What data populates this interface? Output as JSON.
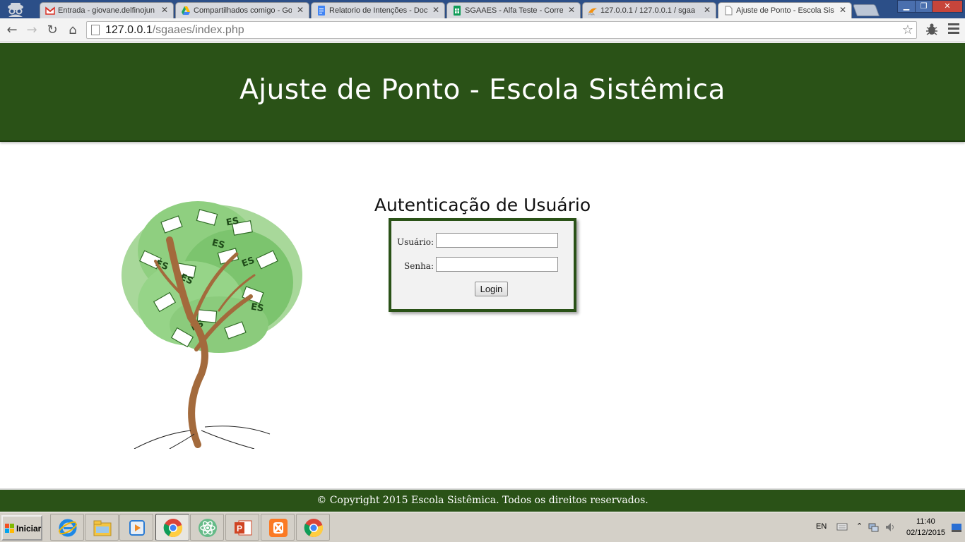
{
  "browser": {
    "tabs": [
      {
        "title": "Entrada - giovane.delfinojun",
        "icon": "gmail-icon",
        "color": "#d93025",
        "active": false
      },
      {
        "title": "Compartilhados comigo - Go",
        "icon": "drive-icon",
        "color": "#1fa463",
        "active": false
      },
      {
        "title": "Relatorio de Intenções - Doc",
        "icon": "docs-icon",
        "color": "#4285f4",
        "active": false
      },
      {
        "title": "SGAAES - Alfa Teste - Corre",
        "icon": "sheets-icon",
        "color": "#0f9d58",
        "active": false
      },
      {
        "title": "127.0.0.1 / 127.0.0.1 / sgaa",
        "icon": "phpmyadmin-icon",
        "color": "#f29111",
        "active": false
      },
      {
        "title": "Ajuste de Ponto - Escola Sist",
        "icon": "page-icon",
        "color": "#888888",
        "active": true
      }
    ],
    "url_host": "127.0.0.1",
    "url_path": "/sgaaes/index.php"
  },
  "page": {
    "header_title": "Ajuste de Ponto - Escola Sistêmica",
    "auth_title": "Autenticação de Usuário",
    "user_label": "Usuário:",
    "user_value": "",
    "password_label": "Senha:",
    "password_value": "",
    "login_button": "Login",
    "footer_text": "© Copyright 2015 Escola Sistêmica. Todos os direitos reservados.",
    "logo_text": "ES"
  },
  "taskbar": {
    "start_label": "Iniciar",
    "apps": [
      "internet-explorer-icon",
      "file-explorer-icon",
      "media-player-icon",
      "chrome-icon",
      "atom-icon",
      "powerpoint-icon",
      "xampp-icon",
      "chrome-icon"
    ],
    "language": "EN",
    "time": "11:40",
    "date": "02/12/2015"
  },
  "colors": {
    "header_green": "#2a5217",
    "tab_bar_blue": "#2c4f88"
  }
}
